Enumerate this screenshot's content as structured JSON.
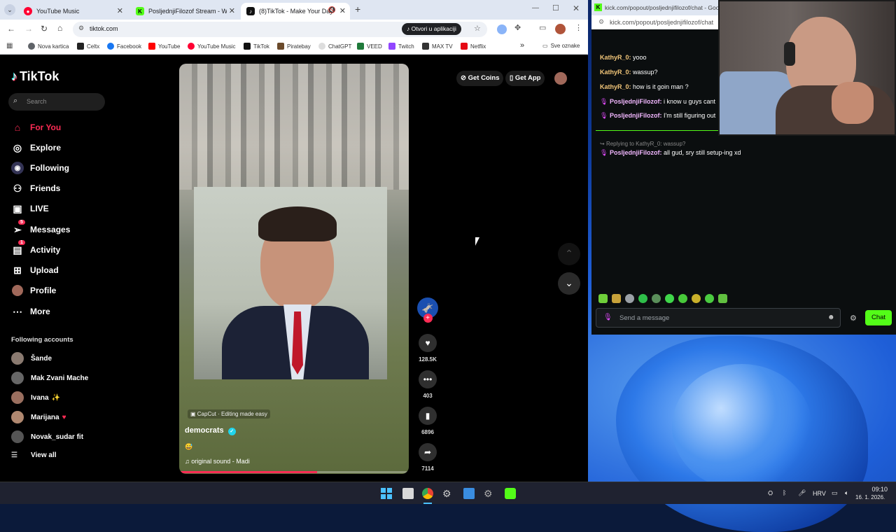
{
  "browser": {
    "tabs": [
      {
        "title": "YouTube Music",
        "favicon_color": "#ff0033"
      },
      {
        "title": "PosljednjiFilozof Stream - Watc",
        "favicon_color": "#53fc18"
      },
      {
        "title": "(8)TikTok - Make Your Day",
        "favicon_color": "#111111"
      }
    ],
    "new_tab": "+",
    "url": "tiktok.com",
    "open_in_app": "Otvori u aplikaciji",
    "bookmarks": [
      {
        "label": "Nova kartica",
        "color": "#5f6368"
      },
      {
        "label": "Celtx",
        "color": "#222222"
      },
      {
        "label": "Facebook",
        "color": "#1877f2"
      },
      {
        "label": "YouTube",
        "color": "#ff0000"
      },
      {
        "label": "YouTube Music",
        "color": "#ff0033"
      },
      {
        "label": "TikTok",
        "color": "#111111"
      },
      {
        "label": "Piratebay",
        "color": "#6b4a2b"
      },
      {
        "label": "ChatGPT",
        "color": "#dddddd"
      },
      {
        "label": "VEED",
        "color": "#1f7a3a"
      },
      {
        "label": "Twitch",
        "color": "#9146ff"
      },
      {
        "label": "MAX TV",
        "color": "#333333"
      },
      {
        "label": "Netflix",
        "color": "#e50914"
      }
    ],
    "more_bookmarks": "»",
    "all_bookmarks": "Sve oznake"
  },
  "tiktok": {
    "logo": "TikTok",
    "search_placeholder": "Search",
    "nav": [
      {
        "label": "For You",
        "icon": "home-icon",
        "active": true
      },
      {
        "label": "Explore",
        "icon": "compass-icon"
      },
      {
        "label": "Following",
        "icon": "following-icon"
      },
      {
        "label": "Friends",
        "icon": "friends-icon"
      },
      {
        "label": "LIVE",
        "icon": "live-icon"
      },
      {
        "label": "Messages",
        "icon": "messages-icon",
        "badge": "5"
      },
      {
        "label": "Activity",
        "icon": "activity-icon",
        "badge": "1"
      },
      {
        "label": "Upload",
        "icon": "upload-icon"
      },
      {
        "label": "Profile",
        "icon": "profile-icon"
      },
      {
        "label": "More",
        "icon": "more-icon"
      }
    ],
    "following_header": "Following accounts",
    "following": [
      {
        "name": "Šande",
        "suffix": ""
      },
      {
        "name": "Mak Zvani Mache",
        "suffix": ""
      },
      {
        "name": "Ivana",
        "suffix": "✨"
      },
      {
        "name": "Marijana",
        "suffix": "♥"
      },
      {
        "name": "Novak_sudar fit",
        "suffix": ""
      }
    ],
    "view_all": "View all",
    "get_coins": "Get Coins",
    "get_app": "Get App",
    "video": {
      "capcut_label": "CapCut · Editing made easy",
      "author": "democrats",
      "emoji": "😅",
      "sound": "original sound - Madi",
      "progress": 0.6
    },
    "actions": {
      "likes": "128.5K",
      "comments": "403",
      "saves": "6896",
      "shares": "7114"
    },
    "accent": "#fe2c55"
  },
  "chat": {
    "popout_url": "kick.com/popout/posljednjifilozof/chat - Goo",
    "address": "kick.com/popout/posljednjifilozof/chat",
    "messages": [
      {
        "user": "KathyR_0:",
        "text": "yooo"
      },
      {
        "user": "KathyR_0:",
        "text": "wassup?"
      },
      {
        "user": "KathyR_0:",
        "text": "how is it goin man ?"
      },
      {
        "user": "PosljednjiFilozof:",
        "text": "i know u guys cant"
      },
      {
        "user": "PosljednjiFilozof:",
        "text": "I'm still figuring out"
      }
    ],
    "reply_to": "Replying to KathyR_0: wassup?",
    "reply": {
      "user": "PosljednjiFilozof:",
      "text": "all gud, sry still setup-ing xd"
    },
    "input_placeholder": "Send a message",
    "send_label": "Chat",
    "accent": "#53fc18"
  },
  "taskbar": {
    "language": "HRV",
    "time": "09:10",
    "date": "16. 1. 2026."
  }
}
